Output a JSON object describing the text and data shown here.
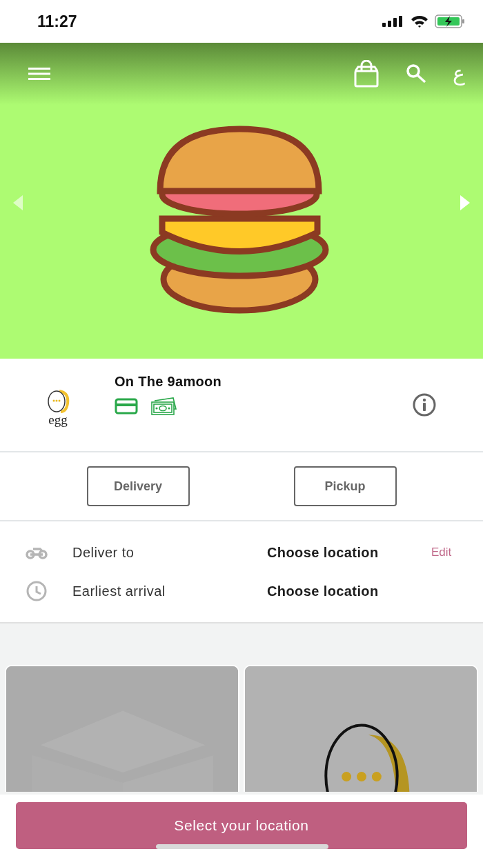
{
  "status_bar": {
    "time": "11:27"
  },
  "header": {
    "language_label": "ع"
  },
  "store": {
    "name": "On The 9amoon",
    "logo_text": "egg"
  },
  "order_types": [
    {
      "label": "Delivery",
      "selected": false
    },
    {
      "label": "Pickup",
      "selected": false
    }
  ],
  "details": [
    {
      "kind": "delivery",
      "label": "Deliver to",
      "value": "Choose location",
      "action": "Edit"
    },
    {
      "kind": "time",
      "label": "Earliest arrival",
      "value": "Choose location"
    }
  ],
  "categories": [
    {
      "kind": "box"
    },
    {
      "kind": "egg"
    }
  ],
  "bottom_button": {
    "label": "Select your location"
  }
}
